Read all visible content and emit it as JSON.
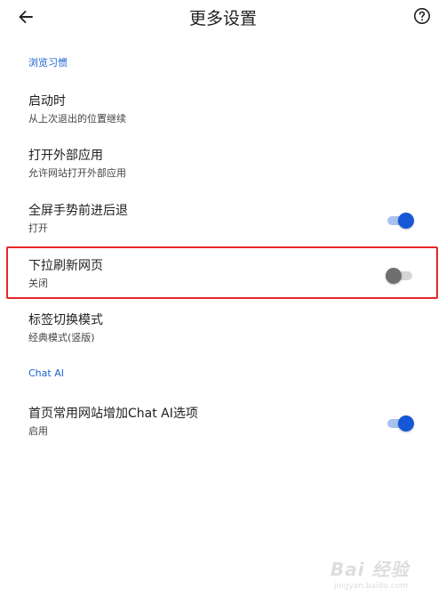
{
  "header": {
    "title": "更多设置",
    "back_icon": "arrow-back-icon",
    "help_icon": "help-circle-icon"
  },
  "sections": [
    {
      "header": "浏览习惯",
      "items": [
        {
          "title": "启动时",
          "subtitle": "从上次退出的位置继续",
          "toggle": null
        },
        {
          "title": "打开外部应用",
          "subtitle": "允许网站打开外部应用",
          "toggle": null
        },
        {
          "title": "全屏手势前进后退",
          "subtitle": "打开",
          "toggle": "on"
        },
        {
          "title": "下拉刷新网页",
          "subtitle": "关闭",
          "toggle": "off"
        },
        {
          "title": "标签切换模式",
          "subtitle": "经典模式(竖版)",
          "toggle": null
        }
      ]
    },
    {
      "header": "Chat AI",
      "items": [
        {
          "title": "首页常用网站增加Chat AI选项",
          "subtitle": "启用",
          "toggle": "on"
        }
      ]
    }
  ],
  "highlight": {
    "target": "下拉刷新网页",
    "color": "#e8262b"
  },
  "colors": {
    "accent": "#1558d6",
    "section_header": "#1a5fd0",
    "toggle_on_track": "#a8c2ee",
    "toggle_off_thumb": "#6f6f6f"
  },
  "watermark": {
    "text": "Bai 经验",
    "url": "jingyan.baidu.com"
  }
}
